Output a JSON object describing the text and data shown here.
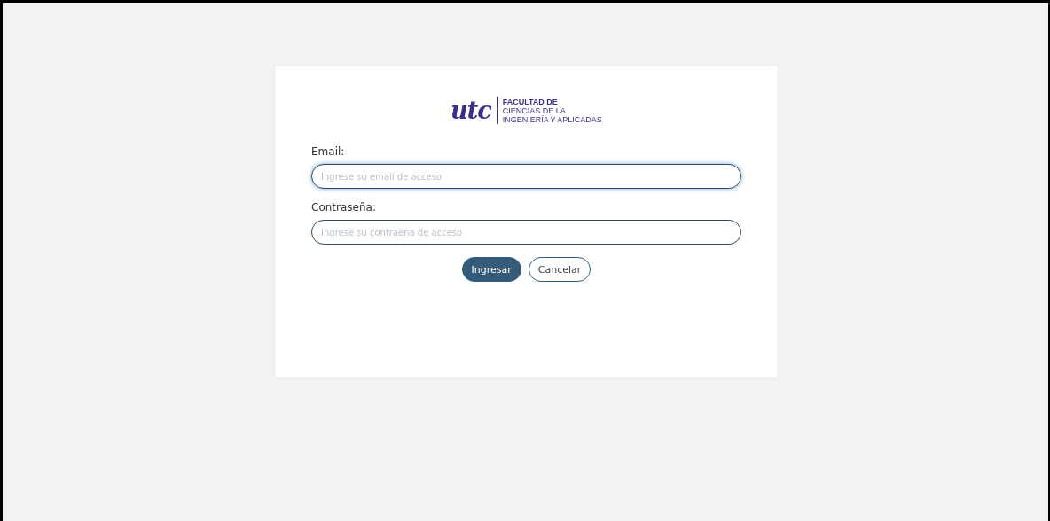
{
  "logo": {
    "mark": "utc",
    "lines": [
      "FACULTAD DE",
      "CIENCIAS DE LA",
      "INGENIERÍA Y APLICADAS"
    ]
  },
  "fields": [
    {
      "label": "Email:",
      "placeholder": "Ingrese su email de acceso",
      "focused": true
    },
    {
      "label": "Contraseña:",
      "placeholder": "Ingrese su contraeña de acceso",
      "focused": false
    }
  ],
  "buttons": [
    {
      "label": "Ingresar",
      "kind": "primary"
    },
    {
      "label": "Cancelar",
      "kind": "outline"
    }
  ]
}
